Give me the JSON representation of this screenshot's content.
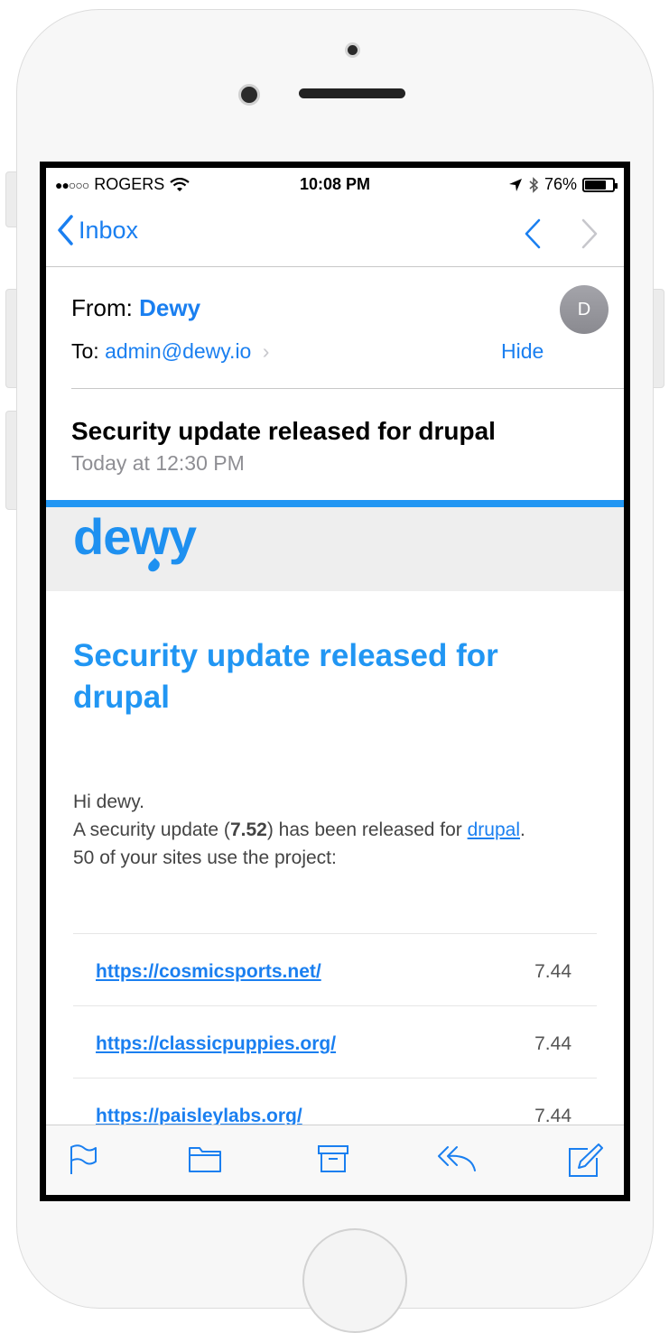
{
  "status_bar": {
    "signal": "●●○○○",
    "carrier": "ROGERS",
    "time": "10:08 PM",
    "battery": "76%",
    "battery_level": 0.76
  },
  "nav": {
    "back_label": "Inbox"
  },
  "header": {
    "from_label": "From:",
    "from_name": "Dewy",
    "to_label": "To:",
    "to_address": "admin@dewy.io",
    "hide_label": "Hide",
    "avatar_initial": "D",
    "subject": "Security update released for drupal",
    "date": "Today at 12:30 PM"
  },
  "email": {
    "logo_text": "dewy",
    "title": "Security update released for drupal",
    "greeting": "Hi dewy.",
    "line1_prefix": "A security update (",
    "version": "7.52",
    "line1_middle": ") has been released for ",
    "project_link": "drupal",
    "line1_suffix": ".",
    "line2": "50 of your sites use the project:",
    "sites": [
      {
        "url": "https://cosmicsports.net/",
        "version": "7.44"
      },
      {
        "url": "https://classicpuppies.org/",
        "version": "7.44"
      },
      {
        "url": "https://paisleylabs.org/",
        "version": "7.44"
      }
    ]
  },
  "colors": {
    "ios_blue": "#1a7ff0",
    "brand_blue": "#2196f3"
  },
  "toolbar": {
    "icons": [
      "flag-icon",
      "folder-icon",
      "archive-icon",
      "reply-icon",
      "compose-icon"
    ]
  }
}
